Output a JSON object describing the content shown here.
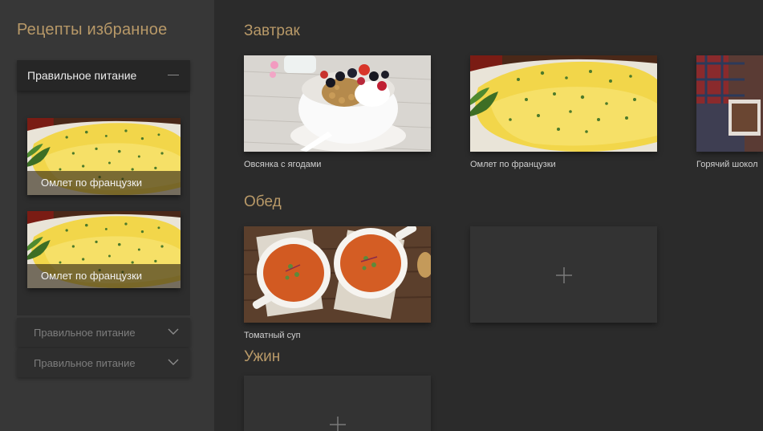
{
  "sidebar": {
    "title": "Рецепты избранное",
    "open_group": {
      "label": "Правильное питание",
      "collapse_icon": "minus-icon",
      "items": [
        {
          "caption": "Омлет по французки",
          "image": "omelette-image"
        },
        {
          "caption": "Омлет по французки",
          "image": "omelette-image"
        }
      ]
    },
    "collapsed_groups": [
      {
        "label": "Правильное питание",
        "icon": "chevron-down-icon"
      },
      {
        "label": "Правильное питание",
        "icon": "chevron-down-icon"
      }
    ]
  },
  "main": {
    "sections": [
      {
        "title": "Завтрак",
        "cards": [
          {
            "caption": "Овсянка с ягодами",
            "image": "oatmeal-berries-image"
          },
          {
            "caption": "Омлет по французки",
            "image": "omelette-image"
          },
          {
            "caption": "Горячий шокол",
            "image": "hot-chocolate-image"
          }
        ]
      },
      {
        "title": "Обед",
        "cards": [
          {
            "caption": "Томатный суп",
            "image": "tomato-soup-image"
          }
        ],
        "add_icon": "plus-icon"
      },
      {
        "title": "Ужин",
        "cards": [],
        "add_icon": "plus-icon"
      }
    ]
  },
  "colors": {
    "accent": "#b89968",
    "background": "#2b2b2b",
    "sidebar": "#373737",
    "card_empty": "#333333"
  }
}
